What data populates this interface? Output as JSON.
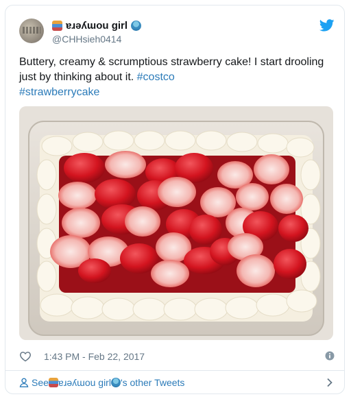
{
  "tweet": {
    "display_name": "ɐɹǝʎɯou girl",
    "handle": "@CHHsieh0414",
    "text_before": "Buttery, creamy & scrumptious strawberry cake! I start drooling just by thinking about it. ",
    "hashtag1": "#costco",
    "hashtag2": "#strawberrycake",
    "timestamp": "1:43 PM - Feb 22, 2017"
  },
  "footer": {
    "see_prefix": "See ",
    "see_name": "ɐɹǝʎɯou girl",
    "see_suffix": "'s other Tweets"
  },
  "icons": [
    "books-emoji",
    "genie-emoji",
    "twitter-bird-icon",
    "heart-icon",
    "info-icon",
    "person-icon",
    "chevron-right-icon"
  ],
  "colors": {
    "link": "#2b7bb9",
    "muted": "#657786",
    "text": "#14171a",
    "brand": "#1da1f2"
  }
}
